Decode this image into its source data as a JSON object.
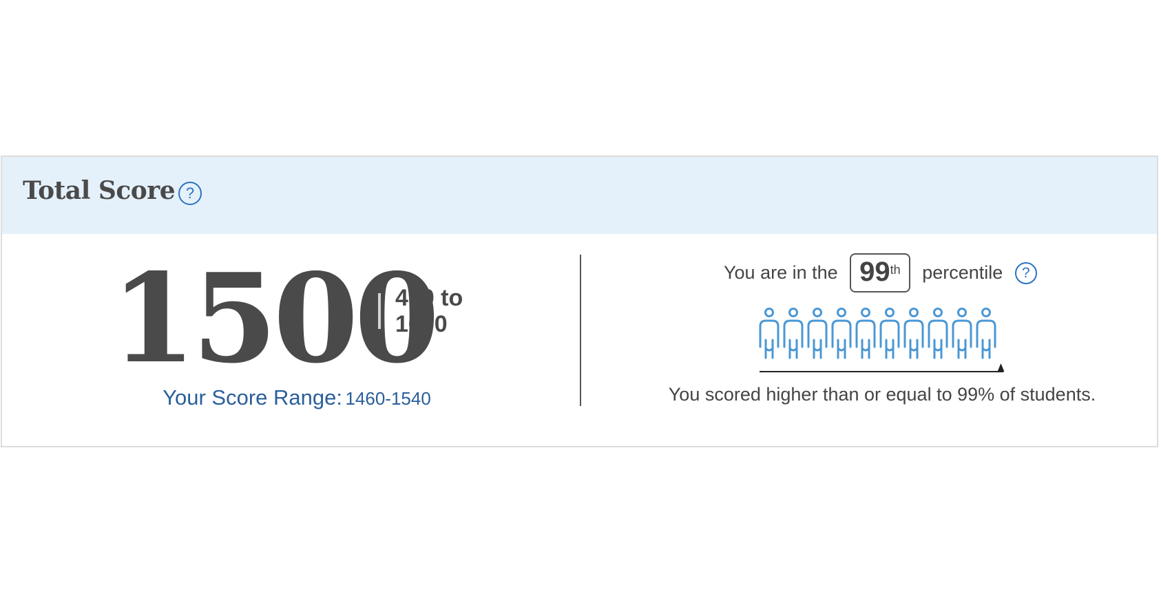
{
  "header": {
    "title": "Total Score",
    "help_symbol": "?",
    "background_color": "#e5f1fa"
  },
  "score": {
    "value": "1500",
    "scale_min_label": "400 to",
    "scale_max_label": "1600",
    "range_label": "Your Score Range:",
    "range_value": "1460-1540"
  },
  "percentile": {
    "prefix": "You are in the",
    "value": "99",
    "suffix": "th",
    "word": "percentile",
    "help_symbol": "?",
    "caption": "You scored higher than or equal to 99% of students.",
    "icon_count": 10,
    "icon_name": "person-icon",
    "icon_color": "#4a97d4",
    "marker_position_percent": 99
  },
  "colors": {
    "accent": "#2a72c2",
    "range_text": "#2a5f9a",
    "text": "#4a4a4a"
  }
}
